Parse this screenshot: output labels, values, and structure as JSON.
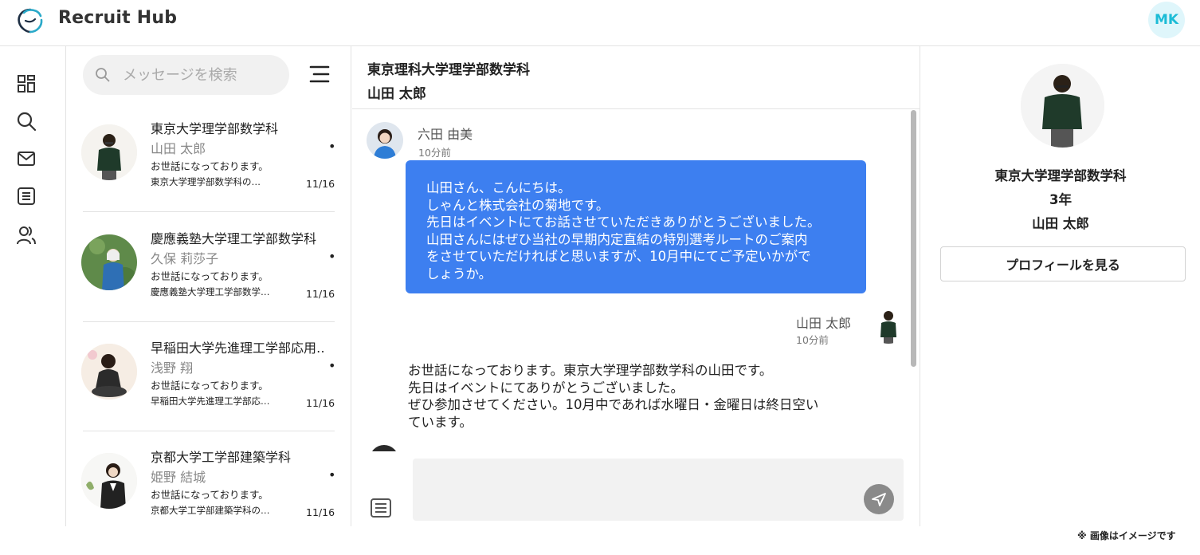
{
  "app": {
    "brand": "Recruit Hub",
    "account_initials": "MK"
  },
  "nav": {
    "items": [
      "dashboard-icon",
      "search-icon",
      "mail-icon",
      "list-icon",
      "users-icon"
    ]
  },
  "search": {
    "placeholder": "メッセージを検索"
  },
  "conversations": [
    {
      "school": "東京大学理学部数学科",
      "name": "山田 太郎",
      "preview": "お世話になっております。",
      "snippet": "東京大学理学部数学科の…",
      "date": "11/16",
      "unread_mark": "•"
    },
    {
      "school": "慶應義塾大学理工学部数学科",
      "name": "久保 莉莎子",
      "preview": "お世話になっております。",
      "snippet": "慶應義塾大学理工学部数学…",
      "date": "11/16",
      "unread_mark": "•"
    },
    {
      "school": "早稲田大学先進理工学部応用‥",
      "name": "浅野 翔",
      "preview": "お世話になっております。",
      "snippet": "早稲田大学先進理工学部応…",
      "date": "11/16",
      "unread_mark": "•"
    },
    {
      "school": "京都大学工学部建築学科",
      "name": "姫野 結城",
      "preview": "お世話になっております。",
      "snippet": "京都大学工学部建築学科の…",
      "date": "11/16",
      "unread_mark": "•"
    }
  ],
  "chat": {
    "header_school": "東京理科大学理学部数学科",
    "header_name": "山田 太郎",
    "messages": [
      {
        "sender": "六田 由美",
        "time": "10分前",
        "lines": [
          "山田さん、こんにちは。",
          "しゃんと株式会社の菊地です。",
          "先日はイベントにてお話させていただきありがとうございました。",
          "山田さんにはぜひ当社の早期内定直結の特別選考ルートのご案内",
          "をさせていただければと思いますが、10月中にてご予定いかがで",
          "しょうか。"
        ]
      },
      {
        "sender": "山田 太郎",
        "time": "10分前",
        "lines": [
          "お世話になっております。東京大学理学部数学科の山田です。",
          "先日はイベントにてありがとうございました。",
          "ぜひ参加させてください。10月中であれば水曜日・金曜日は終日空い",
          "ています。"
        ]
      }
    ],
    "composer_placeholder": ""
  },
  "profile": {
    "school": "東京大学理学部数学科",
    "grade": "3年",
    "name": "山田 太郎",
    "button_label": "プロフィールを見る"
  },
  "footer": {
    "disclaimer": "※ 画像はイメージです"
  },
  "colors": {
    "bubble": "#3d7ff0",
    "accent": "#1cbcd6",
    "send_button": "#8a8a8a"
  }
}
